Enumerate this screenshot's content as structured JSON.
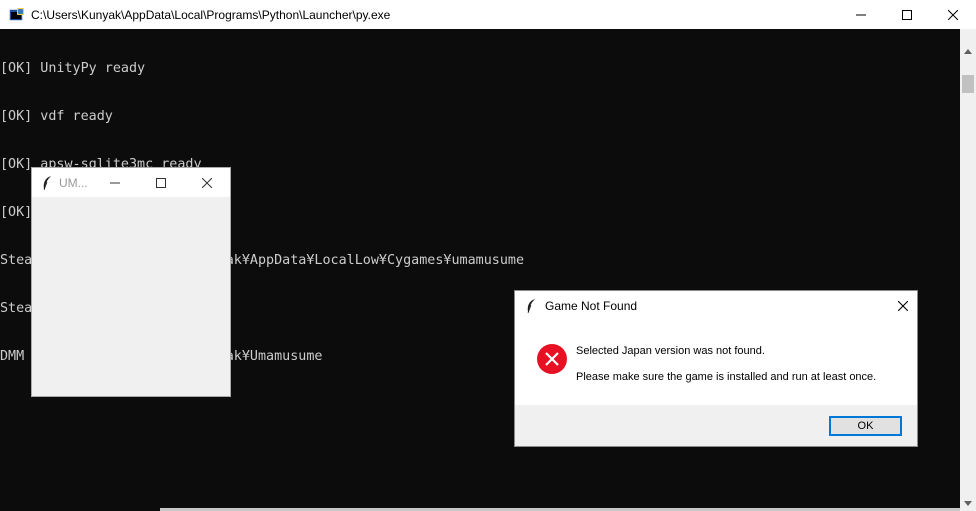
{
  "console": {
    "title": "C:\\Users\\Kunyak\\AppData\\Local\\Programs\\Python\\Launcher\\py.exe",
    "lines": [
      "[OK] UnityPy ready",
      "[OK] vdf ready",
      "[OK] apsw-sqlite3mc ready",
      "[OK] pyyaml",
      "Steam EN path: C:¥Users¥Kunyak¥AppData¥LocalLow¥Cygames¥umamusume",
      "Steam JP path: None",
      "DMM Game path: C:¥Users¥Kunyak¥Umamusume"
    ]
  },
  "tk_window": {
    "title": "UM..."
  },
  "dialog": {
    "title": "Game Not Found",
    "message_line1": "Selected Japan version was not found.",
    "message_line2": "Please make sure the game is installed and run at least once.",
    "ok_label": "OK"
  },
  "icons": {
    "console": "python-console-icon",
    "feather": "feather-icon",
    "error": "error-icon"
  },
  "colors": {
    "console_bg": "#0c0c0c",
    "console_text": "#cccccc",
    "error_red": "#e81123",
    "focus_blue": "#0078d7"
  }
}
